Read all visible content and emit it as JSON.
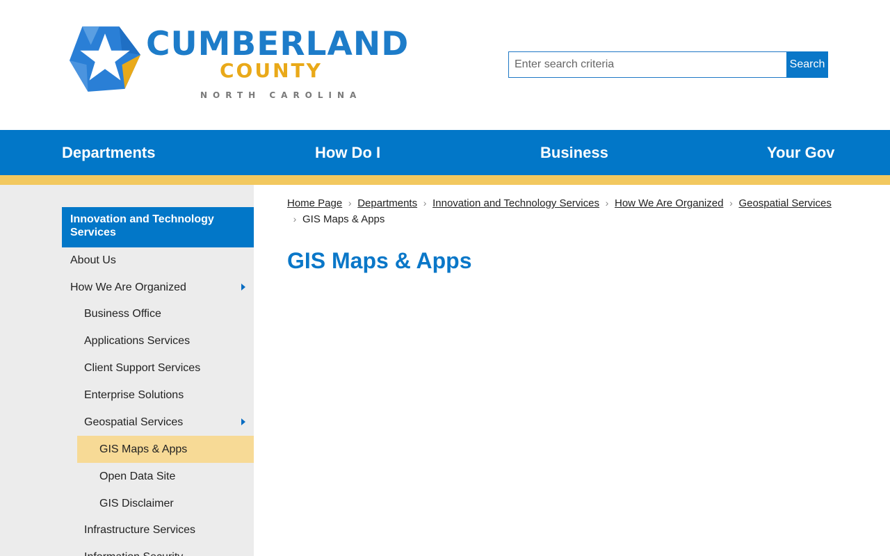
{
  "header": {
    "logo": {
      "title": "CUMBERLAND",
      "subtitle": "COUNTY",
      "state": "NORTH CAROLINA"
    },
    "search": {
      "placeholder": "Enter search criteria",
      "button_label": "Search"
    }
  },
  "nav": {
    "items": [
      "Departments",
      "How Do I",
      "Business",
      "Your Gov"
    ]
  },
  "sidebar": {
    "heading": "Innovation and Technology Services",
    "items": [
      {
        "label": "About Us"
      },
      {
        "label": "How We Are Organized",
        "expandable": true
      },
      {
        "label": "Business Office"
      },
      {
        "label": "Applications Services"
      },
      {
        "label": "Client Support Services"
      },
      {
        "label": "Enterprise Solutions"
      },
      {
        "label": "Geospatial Services",
        "expandable": true
      },
      {
        "label": "GIS Maps & Apps",
        "active": true
      },
      {
        "label": "Open Data Site"
      },
      {
        "label": "GIS Disclaimer"
      },
      {
        "label": "Infrastructure Services"
      },
      {
        "label": "Information Security"
      }
    ]
  },
  "breadcrumb": {
    "links": [
      "Home Page",
      "Departments",
      "Innovation and Technology Services",
      "How We Are Organized",
      "Geospatial Services"
    ],
    "current": "GIS Maps & Apps"
  },
  "main": {
    "title": "GIS Maps & Apps"
  },
  "colors": {
    "primary_blue": "#0277c8",
    "accent_yellow": "#f2c85f",
    "active_highlight": "#f7da96",
    "sidebar_bg": "#ececec"
  }
}
